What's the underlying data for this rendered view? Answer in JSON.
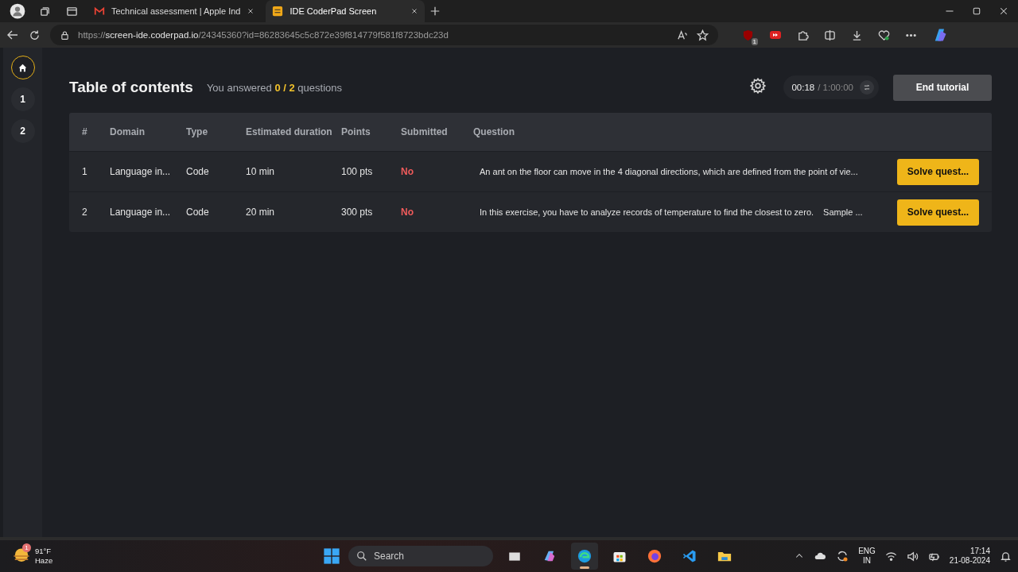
{
  "browser": {
    "tabs": [
      {
        "kind": "gmail",
        "title": "Technical assessment | Apple Ind",
        "selected": false
      },
      {
        "kind": "coderpad",
        "title": "IDE CoderPad Screen",
        "selected": true
      }
    ],
    "address": {
      "scheme": "https://",
      "host": "screen-ide.coderpad.io",
      "path": "/24345360?id=86283645c5c872e39f814779f581f8723bdc23d"
    },
    "extension_badge": "1"
  },
  "sidebar": {
    "items": [
      {
        "kind": "home",
        "selected": true
      },
      {
        "kind": "number",
        "label": "1",
        "selected": false
      },
      {
        "kind": "number",
        "label": "2",
        "selected": false
      }
    ]
  },
  "header": {
    "title": "Table of contents",
    "summary": "You answered **0 / 2** questions",
    "timer": {
      "elapsed": "00:18",
      "total": "/ 1:00:00"
    },
    "end_button": "End tutorial"
  },
  "table": {
    "columns": [
      "#",
      "Domain",
      "Type",
      "Estimated duration",
      "Points",
      "Submitted",
      "Question"
    ],
    "rows": [
      {
        "number": "1",
        "domain": "Language in...",
        "type": "Code",
        "duration": "10 min",
        "points": "100 pts",
        "submitted": "No",
        "question": [
          "An ant on the floor can move in the 4 diagonal directions, which are defined from the point of vie..."
        ],
        "action": "Solve quest..."
      },
      {
        "number": "2",
        "domain": "Language in...",
        "type": "Code",
        "duration": "20 min",
        "points": "300 pts",
        "submitted": "No",
        "question": [
          "In this exercise, you have to analyze records of temperature to find the closest to zero.",
          "Sample ..."
        ],
        "action": "Solve quest..."
      }
    ]
  },
  "taskbar": {
    "weather": {
      "temperature": "91°F",
      "condition": "Haze",
      "badge": "1"
    },
    "search_placeholder": "Search",
    "apps": [
      {
        "kind": "taskview",
        "selected": false
      },
      {
        "kind": "copilot",
        "selected": false
      },
      {
        "kind": "edge",
        "selected": true
      },
      {
        "kind": "store",
        "selected": false
      },
      {
        "kind": "firefox",
        "selected": false
      },
      {
        "kind": "vscode",
        "selected": false
      },
      {
        "kind": "explorer",
        "selected": false
      }
    ],
    "language": [
      "ENG",
      "IN"
    ],
    "time": "17:14",
    "date": "21-08-2024"
  }
}
